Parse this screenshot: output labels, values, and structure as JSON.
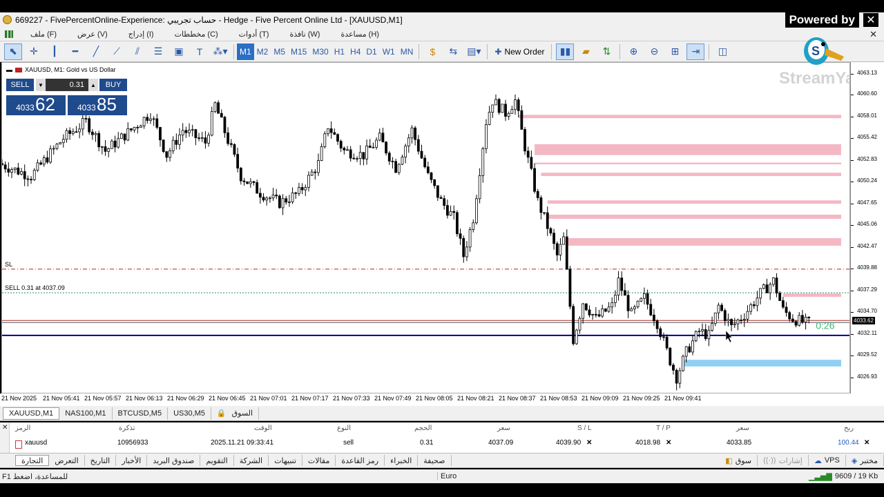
{
  "window": {
    "title": "669227 - FivePercentOnline-Experience: حساب تجريبي - Hedge - Five Percent Online Ltd - [XAUUSD,M1]",
    "overlay_text": "Powered by",
    "watermark": "StreamYard"
  },
  "menu": [
    "ملف (F)",
    "عرض (V)",
    "إدراج (I)",
    "مخططات (C)",
    "أدوات (T)",
    "نافذة (W)",
    "مساعدة (H)"
  ],
  "toolbar": {
    "timeframes": [
      "M1",
      "M2",
      "M5",
      "M15",
      "M30",
      "H1",
      "H4",
      "D1",
      "W1",
      "MN"
    ],
    "active_timeframe": "M1",
    "new_order": "New Order"
  },
  "chart": {
    "symbol_label": "XAUUSD, M1:  Gold vs US Dollar",
    "one_click": {
      "sell_label": "SELL",
      "buy_label": "BUY",
      "volume": "0.31",
      "sell_small": "4033",
      "sell_big": "62",
      "buy_small": "4033",
      "buy_big": "85"
    },
    "sl_label": "SL",
    "order_label": "SELL 0.31 at 4037.09",
    "countdown": "0:26",
    "current_price_tag": "4033.62",
    "price_labels": [
      "4063.13",
      "4060.60",
      "4058.01",
      "4055.42",
      "4052.83",
      "4050.24",
      "4047.65",
      "4045.06",
      "4042.47",
      "4039.88",
      "4037.29",
      "4034.70",
      "4032.11",
      "4029.52",
      "4026.93"
    ],
    "time_labels": [
      "21 Nov 2025",
      "21 Nov 05:41",
      "21 Nov 05:57",
      "21 Nov 06:13",
      "21 Nov 06:29",
      "21 Nov 06:45",
      "21 Nov 07:01",
      "21 Nov 07:17",
      "21 Nov 07:33",
      "21 Nov 07:49",
      "21 Nov 08:05",
      "21 Nov 08:21",
      "21 Nov 08:37",
      "21 Nov 08:53",
      "21 Nov 09:09",
      "21 Nov 09:25",
      "21 Nov 09:41"
    ]
  },
  "chart_data": {
    "type": "candlestick",
    "symbol": "XAUUSD",
    "timeframe": "M1",
    "ylim": [
      4025.0,
      4064.5
    ],
    "x_range": [
      "05:25",
      "09:48"
    ],
    "levels": {
      "stop_loss": 4039.9,
      "entry": 4037.09,
      "bid": 4033.62,
      "horizontal_line": 4032.0
    },
    "path": [
      [
        "05:25",
        4052.5
      ],
      [
        "05:35",
        4051.0
      ],
      [
        "05:45",
        4055.5
      ],
      [
        "05:52",
        4057.5
      ],
      [
        "05:58",
        4054.0
      ],
      [
        "06:06",
        4056.5
      ],
      [
        "06:12",
        4058.5
      ],
      [
        "06:17",
        4053.5
      ],
      [
        "06:22",
        4056.5
      ],
      [
        "06:29",
        4055.0
      ],
      [
        "06:32",
        4059.5
      ],
      [
        "06:40",
        4051.0
      ],
      [
        "06:46",
        4049.0
      ],
      [
        "06:52",
        4047.8
      ],
      [
        "06:58",
        4049.0
      ],
      [
        "07:04",
        4052.5
      ],
      [
        "07:07",
        4057.0
      ],
      [
        "07:12",
        4054.0
      ],
      [
        "07:18",
        4053.5
      ],
      [
        "07:23",
        4055.5
      ],
      [
        "07:28",
        4052.0
      ],
      [
        "07:33",
        4056.5
      ],
      [
        "07:38",
        4051.0
      ],
      [
        "07:42",
        4048.0
      ],
      [
        "07:46",
        4046.0
      ],
      [
        "07:49",
        4041.5
      ],
      [
        "07:52",
        4046.0
      ],
      [
        "07:56",
        4057.5
      ],
      [
        "07:58",
        4060.0
      ],
      [
        "08:02",
        4058.5
      ],
      [
        "08:05",
        4060.0
      ],
      [
        "08:08",
        4054.5
      ],
      [
        "08:12",
        4048.0
      ],
      [
        "08:15",
        4045.0
      ],
      [
        "08:18",
        4041.5
      ],
      [
        "08:20",
        4043.5
      ],
      [
        "08:23",
        4031.5
      ],
      [
        "08:26",
        4036.0
      ],
      [
        "08:30",
        4034.0
      ],
      [
        "08:35",
        4035.5
      ],
      [
        "08:37",
        4038.5
      ],
      [
        "08:41",
        4034.5
      ],
      [
        "08:45",
        4036.5
      ],
      [
        "08:49",
        4033.5
      ],
      [
        "08:53",
        4029.0
      ],
      [
        "08:55",
        4027.0
      ],
      [
        "08:58",
        4030.0
      ],
      [
        "09:02",
        4032.5
      ],
      [
        "09:05",
        4032.0
      ],
      [
        "09:08",
        4035.5
      ],
      [
        "09:12",
        4033.0
      ],
      [
        "09:16",
        4034.5
      ],
      [
        "09:21",
        4037.0
      ],
      [
        "09:25",
        4038.5
      ],
      [
        "09:28",
        4035.0
      ],
      [
        "09:31",
        4034.0
      ],
      [
        "09:35",
        4033.5
      ]
    ],
    "zones": [
      {
        "low": 4057.9,
        "high": 4058.3,
        "from": "08:05",
        "to": "09:45",
        "color": "#f4b8c4"
      },
      {
        "low": 4053.5,
        "high": 4054.8,
        "from": "08:10",
        "to": "09:45",
        "color": "#f4b8c4"
      },
      {
        "low": 4052.4,
        "high": 4052.6,
        "from": "08:10",
        "to": "09:45",
        "color": "#f4b8c4"
      },
      {
        "low": 4051.0,
        "high": 4051.4,
        "from": "08:12",
        "to": "09:45",
        "color": "#f4b8c4"
      },
      {
        "low": 4047.7,
        "high": 4048.1,
        "from": "08:14",
        "to": "09:45",
        "color": "#f4b8c4"
      },
      {
        "low": 4045.9,
        "high": 4046.4,
        "from": "08:14",
        "to": "09:45",
        "color": "#f4b8c4"
      },
      {
        "low": 4042.7,
        "high": 4043.6,
        "from": "08:20",
        "to": "09:45",
        "color": "#f4b8c4"
      },
      {
        "low": 4036.6,
        "high": 4037.0,
        "from": "09:27",
        "to": "09:45",
        "color": "#f4b8c4"
      },
      {
        "low": 4028.3,
        "high": 4029.1,
        "from": "08:56",
        "to": "09:45",
        "color": "#8fd0f2"
      }
    ]
  },
  "symbol_tabs": [
    "XAUUSD,M1",
    "NAS100,M1",
    "BTCUSD,M5",
    "US30,M5",
    "السوق"
  ],
  "trade": {
    "headers": [
      "الرمز",
      "تذكرة",
      "الوقت",
      "النوع",
      "الحجم",
      "سعر",
      "S / L",
      "T / P",
      "سعر",
      "ربح"
    ],
    "row": [
      "xauusd",
      "10956933",
      "2025.11.21 09:33:41",
      "sell",
      "0.31",
      "4037.09",
      "4039.90",
      "4018.98",
      "4033.85",
      "100.44"
    ]
  },
  "bottom_tabs": [
    "التجارة",
    "التعرض",
    "التاريخ",
    "الأخبار",
    "صندوق البريد",
    "التقويم",
    "الشركة",
    "تنبيهات",
    "مقالات",
    "رمز القاعدة",
    "الخبراء",
    "صحيفة"
  ],
  "bottom_right": [
    "سوق",
    "إشارات",
    "VPS",
    "مختبر"
  ],
  "status": {
    "help": "F1 للمساعدة، اضغط",
    "profile": "Euro",
    "net": "9609 / 19 Kb"
  },
  "colors": {
    "candle": "#000000",
    "resistance_zone": "#f4b8c4",
    "support_zone": "#8fd0f2",
    "sl_line": "#b22222",
    "entry_line": "#2e8b57",
    "bid_line": "#a52a2a",
    "hline": "#00008b",
    "countdown": "#3cb371",
    "one_click_bg": "#1f4a8c"
  }
}
